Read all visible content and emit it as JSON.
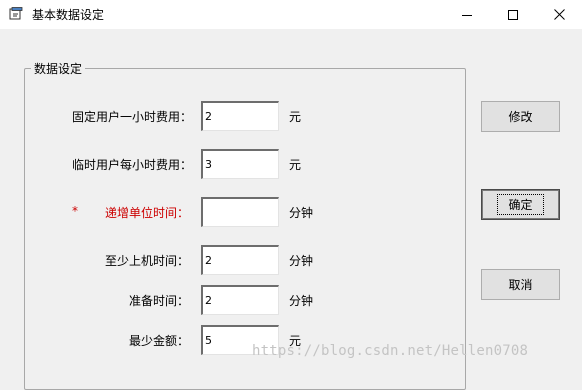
{
  "window": {
    "title": "基本数据设定",
    "controls": {
      "minimize": "minimize-icon",
      "maximize": "maximize-icon",
      "close": "close-icon"
    }
  },
  "group": {
    "legend": "数据设定",
    "rows": [
      {
        "label": "固定用户一小时费用：",
        "value": "2",
        "unit": "元"
      },
      {
        "label": "临时用户每小时费用：",
        "value": "3",
        "unit": "元"
      },
      {
        "label": "递增单位时间：",
        "value": "",
        "unit": "分钟",
        "required_mark": "*"
      },
      {
        "label": "至少上机时间：",
        "value": "2",
        "unit": "分钟"
      },
      {
        "label": "准备时间：",
        "value": "2",
        "unit": "分钟"
      },
      {
        "label": "最少金额：",
        "value": "5",
        "unit": "元"
      }
    ]
  },
  "buttons": {
    "modify": "修改",
    "confirm": "确定",
    "cancel": "取消"
  },
  "watermark": "https://blog.csdn.net/Hellen0708",
  "colors": {
    "required": "#cc0000",
    "window_bg": "#f0f0f0",
    "titlebar_bg": "#ffffff"
  }
}
